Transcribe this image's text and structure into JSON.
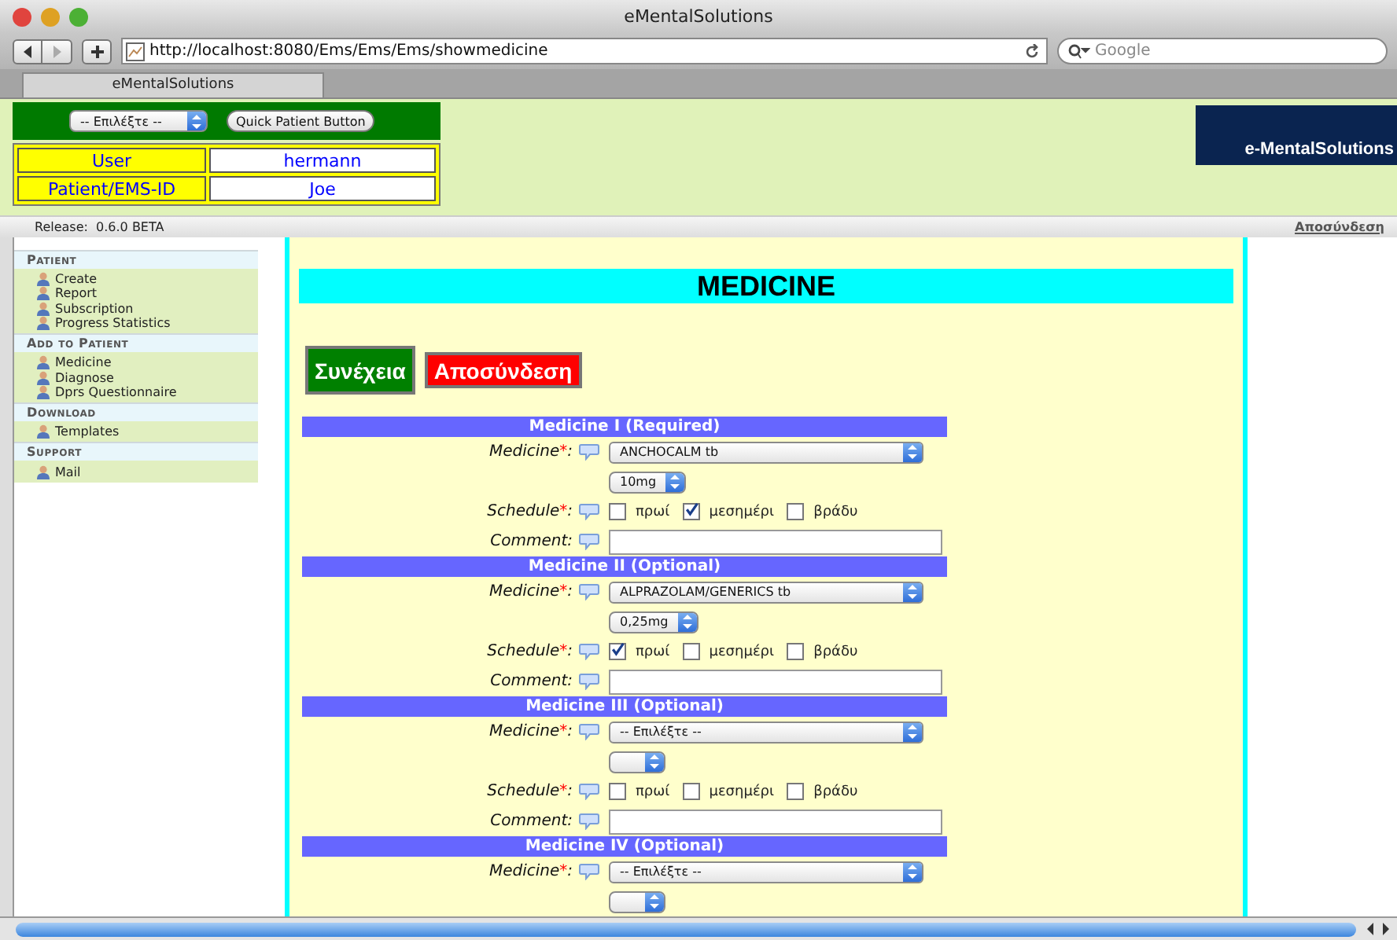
{
  "browser": {
    "title": "eMentalSolutions",
    "url": "http://localhost:8080/Ems/Ems/Ems/showmedicine",
    "search_placeholder": "Google",
    "tab": "eMentalSolutions"
  },
  "header": {
    "select": "-- Επιλέξτε --",
    "quick_button": "Quick Patient Button",
    "logo": "e-MentalSolutions",
    "info": [
      {
        "label": "User",
        "value": "hermann"
      },
      {
        "label": "Patient/EMS-ID",
        "value": "Joe"
      }
    ]
  },
  "release": "Release:  0.6.0 BETA",
  "logout_link": "Αποσύνδεση",
  "sidebar": [
    {
      "title": "Patient",
      "items": [
        "Create",
        "Report",
        "Subscription",
        "Progress Statistics"
      ]
    },
    {
      "title": "Add to Patient",
      "items": [
        "Medicine",
        "Diagnose",
        "Dprs Questionnaire"
      ]
    },
    {
      "title": "Download",
      "items": [
        "Templates"
      ]
    },
    {
      "title": "Support",
      "items": [
        "Mail"
      ]
    }
  ],
  "main": {
    "title": "MEDICINE",
    "buttons": [
      {
        "label": "Συνέχεια",
        "kind": "continue"
      },
      {
        "label": "Αποσύνδεση",
        "kind": "logout"
      }
    ],
    "sections": [
      {
        "heading": "Medicine I (Required)",
        "medicine_label": "Medicine",
        "mark": "*",
        "colon": ":",
        "medicine": "ANCHOCALM tb",
        "dose": "10mg",
        "schedule_label": "Schedule",
        "schedule": [
          {
            "label": "πρωί",
            "checked": false
          },
          {
            "label": "μεσημέρι",
            "checked": true
          },
          {
            "label": "βράδυ",
            "checked": false
          }
        ],
        "comment_label": "Comment:"
      },
      {
        "heading": "Medicine II (Optional)",
        "medicine_label": "Medicine",
        "mark": "*",
        "colon": ":",
        "medicine": "ALPRAZOLAM/GENERICS tb",
        "dose": "0,25mg",
        "schedule_label": "Schedule",
        "schedule": [
          {
            "label": "πρωί",
            "checked": true
          },
          {
            "label": "μεσημέρι",
            "checked": false
          },
          {
            "label": "βράδυ",
            "checked": false
          }
        ],
        "comment_label": "Comment:"
      },
      {
        "heading": "Medicine III (Optional)",
        "medicine_label": "Medicine",
        "mark": "*",
        "colon": ":",
        "medicine": "-- Επιλέξτε --",
        "schedule_label": "Schedule",
        "schedule": [
          {
            "label": "πρωί",
            "checked": false
          },
          {
            "label": "μεσημέρι",
            "checked": false
          },
          {
            "label": "βράδυ",
            "checked": false
          }
        ],
        "comment_label": "Comment:"
      },
      {
        "heading": "Medicine IV (Optional)",
        "medicine_label": "Medicine",
        "mark": "*",
        "colon": ":",
        "medicine": "-- Επιλέξτε --"
      }
    ]
  }
}
